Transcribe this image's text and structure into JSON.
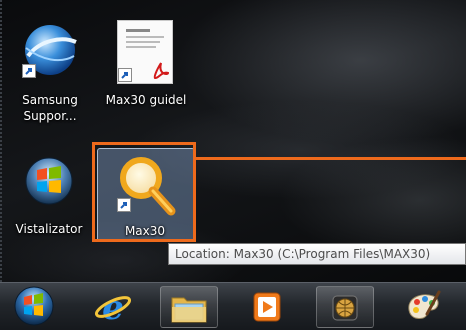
{
  "desktop": {
    "icons": [
      {
        "label_line1": "Samsung",
        "label_line2": "Suppor...",
        "icon": "samsung-support-globe-icon"
      },
      {
        "label_line1": "Max30 guidel",
        "icon": "pdf-document-icon"
      },
      {
        "label_line1": "Vistalizator",
        "icon": "windows-logo-icon"
      },
      {
        "label_line1": "Max30",
        "icon": "magnifier-icon"
      }
    ],
    "tooltip": "Location: Max30 (C:\\Program Files\\MAX30)"
  },
  "taskbar": {
    "items": [
      {
        "name": "start-button",
        "icon": "windows-orb-icon"
      },
      {
        "name": "internet-explorer",
        "icon": "internet-explorer-icon"
      },
      {
        "name": "windows-explorer",
        "icon": "folder-icon"
      },
      {
        "name": "media-player",
        "icon": "media-player-icon"
      },
      {
        "name": "globe-app",
        "icon": "globe-icon"
      },
      {
        "name": "paint",
        "icon": "paint-palette-icon"
      }
    ]
  },
  "colors": {
    "highlight": "#ee6a1c",
    "selection": "#82a0c8",
    "tooltip_text": "#4c4c4c"
  }
}
